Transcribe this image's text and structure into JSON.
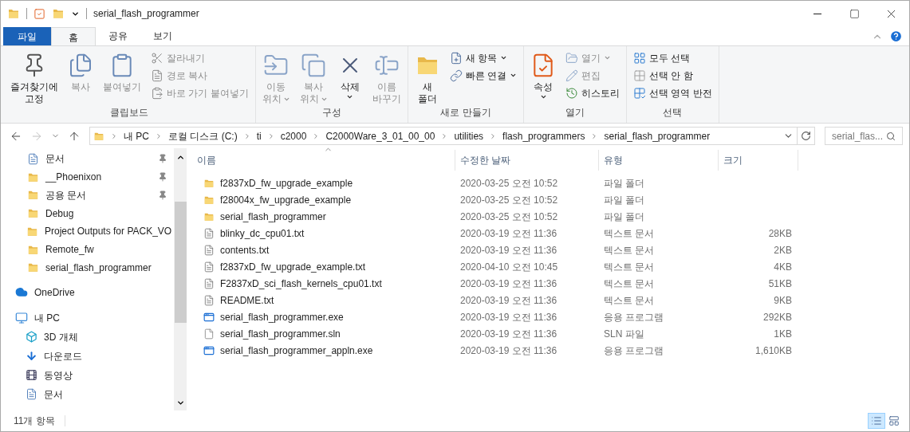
{
  "window": {
    "title": "serial_flash_programmer"
  },
  "ribbon_tabs": [
    {
      "label": "파일",
      "kind": "file",
      "selected": false
    },
    {
      "label": "홈",
      "kind": "tab",
      "selected": true
    },
    {
      "label": "공유",
      "kind": "tab",
      "selected": false
    },
    {
      "label": "보기",
      "kind": "tab",
      "selected": false
    }
  ],
  "ribbon": {
    "groups": [
      {
        "label": "클립보드",
        "items": [
          {
            "kind": "large",
            "lines": [
              "즐겨찾기에",
              "고정"
            ],
            "disabled": false,
            "dropdown": false
          },
          {
            "kind": "large",
            "lines": [
              "복사"
            ],
            "disabled": true,
            "dropdown": false
          },
          {
            "kind": "large",
            "lines": [
              "붙여넣기"
            ],
            "disabled": true,
            "dropdown": false
          },
          {
            "kind": "small",
            "label": "잘라내기",
            "disabled": true,
            "dropdown": false
          },
          {
            "kind": "small",
            "label": "경로 복사",
            "disabled": true,
            "dropdown": false
          },
          {
            "kind": "small",
            "label": "바로 가기 붙여넣기",
            "disabled": true,
            "dropdown": false
          }
        ]
      },
      {
        "label": "구성",
        "items": [
          {
            "kind": "large",
            "lines": [
              "이동",
              "위치"
            ],
            "disabled": true,
            "dropdown": true
          },
          {
            "kind": "large",
            "lines": [
              "복사",
              "위치"
            ],
            "disabled": true,
            "dropdown": true
          },
          {
            "kind": "large",
            "lines": [
              "삭제"
            ],
            "disabled": false,
            "dropdown": true
          },
          {
            "kind": "large",
            "lines": [
              "이름",
              "바꾸기"
            ],
            "disabled": true,
            "dropdown": false
          }
        ]
      },
      {
        "label": "새로 만들기",
        "items": [
          {
            "kind": "large",
            "lines": [
              "새",
              "폴더"
            ],
            "disabled": false,
            "dropdown": false
          },
          {
            "kind": "small",
            "label": "새 항목",
            "disabled": false,
            "dropdown": true
          },
          {
            "kind": "small",
            "label": "빠른 연결",
            "disabled": false,
            "dropdown": true
          }
        ]
      },
      {
        "label": "열기",
        "items": [
          {
            "kind": "large",
            "lines": [
              "속성"
            ],
            "disabled": false,
            "dropdown": true
          },
          {
            "kind": "small",
            "label": "열기",
            "disabled": true,
            "dropdown": true
          },
          {
            "kind": "small",
            "label": "편집",
            "disabled": true,
            "dropdown": false
          },
          {
            "kind": "small",
            "label": "히스토리",
            "disabled": false,
            "dropdown": false
          }
        ]
      },
      {
        "label": "선택",
        "items": [
          {
            "kind": "small",
            "label": "모두 선택",
            "disabled": false,
            "dropdown": false
          },
          {
            "kind": "small",
            "label": "선택 안 함",
            "disabled": false,
            "dropdown": false
          },
          {
            "kind": "small",
            "label": "선택 영역 반전",
            "disabled": false,
            "dropdown": false
          }
        ]
      }
    ]
  },
  "navigation": [
    {
      "kind": "back",
      "disabled": false
    },
    {
      "kind": "forward",
      "disabled": true
    },
    {
      "kind": "recent",
      "disabled": false
    },
    {
      "kind": "up",
      "disabled": false
    }
  ],
  "breadcrumb": [
    "내 PC",
    "로컬 디스크 (C:)",
    "ti",
    "c2000",
    "C2000Ware_3_01_00_00",
    "utilities",
    "flash_programmers",
    "serial_flash_programmer"
  ],
  "search": {
    "placeholder": "serial_flas..."
  },
  "sidebar": {
    "quick_access": [
      {
        "label": "문서",
        "kind": "document",
        "pinned": true
      },
      {
        "label": "__Phoenixon",
        "kind": "folder",
        "pinned": true
      },
      {
        "label": "공용 문서",
        "kind": "folder",
        "pinned": true
      },
      {
        "label": "Debug",
        "kind": "folder"
      },
      {
        "label": "Project Outputs for PACK_VO",
        "kind": "folder"
      },
      {
        "label": "Remote_fw",
        "kind": "folder"
      },
      {
        "label": "serial_flash_programmer",
        "kind": "folder"
      }
    ],
    "places": [
      {
        "label": "OneDrive",
        "kind": "onedrive"
      },
      {
        "label": "내 PC",
        "kind": "pc",
        "children": [
          {
            "label": "3D 개체",
            "kind": "cube"
          },
          {
            "label": "다운로드",
            "kind": "download"
          },
          {
            "label": "동영상",
            "kind": "video"
          },
          {
            "label": "문서",
            "kind": "document"
          }
        ]
      }
    ]
  },
  "table": {
    "columns": [
      {
        "label": "이름",
        "sorted": true
      },
      {
        "label": "수정한 날짜",
        "sorted": false
      },
      {
        "label": "유형",
        "sorted": false
      },
      {
        "label": "크기",
        "sorted": false
      }
    ],
    "rows": [
      {
        "kind": "folder",
        "name": "f2837xD_fw_upgrade_example",
        "date": "2020-03-25 오전 10:52",
        "type": "파일 폴더"
      },
      {
        "kind": "folder",
        "name": "f28004x_fw_upgrade_example",
        "date": "2020-03-25 오전 10:52",
        "type": "파일 폴더"
      },
      {
        "kind": "folder",
        "name": "serial_flash_programmer",
        "date": "2020-03-25 오전 10:52",
        "type": "파일 폴더"
      },
      {
        "kind": "text",
        "name": "blinky_dc_cpu01.txt",
        "date": "2020-03-19 오전 11:36",
        "type": "텍스트 문서",
        "size": "28KB"
      },
      {
        "kind": "text",
        "name": "contents.txt",
        "date": "2020-03-19 오전 11:36",
        "type": "텍스트 문서",
        "size": "2KB"
      },
      {
        "kind": "text",
        "name": "f2837xD_fw_upgrade_example.txt",
        "date": "2020-04-10 오전 10:45",
        "type": "텍스트 문서",
        "size": "4KB"
      },
      {
        "kind": "text",
        "name": "F2837xD_sci_flash_kernels_cpu01.txt",
        "date": "2020-03-19 오전 11:36",
        "type": "텍스트 문서",
        "size": "51KB"
      },
      {
        "kind": "text",
        "name": "README.txt",
        "date": "2020-03-19 오전 11:36",
        "type": "텍스트 문서",
        "size": "9KB"
      },
      {
        "kind": "exe",
        "name": "serial_flash_programmer.exe",
        "date": "2020-03-19 오전 11:36",
        "type": "응용 프로그램",
        "size": "292KB"
      },
      {
        "kind": "file",
        "name": "serial_flash_programmer.sln",
        "date": "2020-03-19 오전 11:36",
        "type": "SLN 파일",
        "size": "1KB"
      },
      {
        "kind": "exe",
        "name": "serial_flash_programmer_appln.exe",
        "date": "2020-03-19 오전 11:36",
        "type": "응용 프로그램",
        "size": "1,610KB"
      }
    ]
  },
  "status_bar": {
    "item_count": "11개 항목",
    "views": [
      {
        "kind": "details",
        "selected": true
      },
      {
        "kind": "large_icons",
        "selected": false
      }
    ]
  }
}
